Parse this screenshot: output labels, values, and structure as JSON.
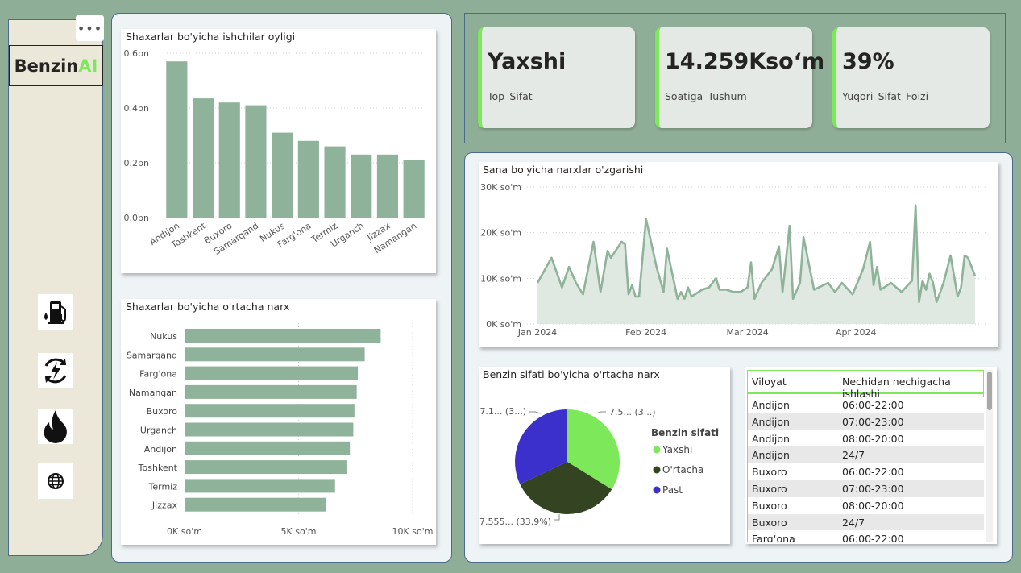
{
  "app": {
    "brand_main": "Benzin",
    "brand_accent": "AI",
    "more_label": "•••"
  },
  "nav": [
    {
      "name": "fuel-station-icon"
    },
    {
      "name": "energy-refresh-icon"
    },
    {
      "name": "flame-icon"
    },
    {
      "name": "globe-icon"
    }
  ],
  "kpis": [
    {
      "value": "Yaxshi",
      "label": "Top_Sifat"
    },
    {
      "value": "14.259Kso‘m",
      "label": "Soatiga_Tushum"
    },
    {
      "value": "39%",
      "label": "Yuqori_Sifat_Foizi"
    }
  ],
  "colors": {
    "bar": "#8fb39a",
    "accent": "#7ee85b",
    "pie_yaxshi": "#7ee85b",
    "pie_ortacha": "#344321",
    "pie_past": "#3b30cc"
  },
  "chart_data": [
    {
      "type": "bar",
      "title": "Shaxarlar bo'yicha ishchilar oyligi",
      "categories": [
        "Andijon",
        "Toshkent",
        "Buxoro",
        "Samarqand",
        "Nukus",
        "Farg'ona",
        "Termiz",
        "Urganch",
        "Jizzax",
        "Namangan"
      ],
      "values": [
        0.57,
        0.435,
        0.42,
        0.41,
        0.31,
        0.28,
        0.26,
        0.23,
        0.23,
        0.21
      ],
      "yticks": [
        "0.0bn",
        "0.2bn",
        "0.4bn",
        "0.6bn"
      ],
      "ylim": [
        0,
        0.6
      ],
      "grid": true
    },
    {
      "type": "bar",
      "orientation": "horizontal",
      "title": "Shaxarlar bo'yicha o'rtacha narx",
      "categories": [
        "Nukus",
        "Samarqand",
        "Farg'ona",
        "Namangan",
        "Buxoro",
        "Urganch",
        "Andijon",
        "Toshkent",
        "Termiz",
        "Jizzax"
      ],
      "values": [
        8600,
        7900,
        7600,
        7550,
        7450,
        7400,
        7250,
        7100,
        6600,
        6200
      ],
      "xticks": [
        "0K so'm",
        "5K so'm",
        "10K so'm"
      ],
      "xlim": [
        0,
        10000
      ],
      "grid": true
    },
    {
      "type": "area",
      "title": "Sana bo'yicha narxlar o'zgarishi",
      "x": [
        "2024-01-01",
        "2024-01-05",
        "2024-01-08",
        "2024-01-10",
        "2024-01-12",
        "2024-01-14",
        "2024-01-17",
        "2024-01-19",
        "2024-01-21",
        "2024-01-22",
        "2024-01-25",
        "2024-01-26",
        "2024-01-27",
        "2024-01-28",
        "2024-01-29",
        "2024-01-30",
        "2024-02-01",
        "2024-02-04",
        "2024-02-06",
        "2024-02-07",
        "2024-02-10",
        "2024-02-11",
        "2024-02-12",
        "2024-02-13",
        "2024-02-14",
        "2024-02-17",
        "2024-02-19",
        "2024-02-21",
        "2024-02-22",
        "2024-02-24",
        "2024-02-26",
        "2024-02-28",
        "2024-03-01",
        "2024-03-02",
        "2024-03-03",
        "2024-03-05",
        "2024-03-08",
        "2024-03-10",
        "2024-03-11",
        "2024-03-13",
        "2024-03-14",
        "2024-03-16",
        "2024-03-17",
        "2024-03-20",
        "2024-03-24",
        "2024-03-26",
        "2024-03-28",
        "2024-03-31",
        "2024-04-03",
        "2024-04-05",
        "2024-04-06",
        "2024-04-07",
        "2024-04-08",
        "2024-04-09",
        "2024-04-11",
        "2024-04-14",
        "2024-04-17",
        "2024-04-18",
        "2024-04-19",
        "2024-04-20",
        "2024-04-21",
        "2024-04-22",
        "2024-04-23",
        "2024-04-24",
        "2024-04-26",
        "2024-04-28",
        "2024-04-30",
        "2024-05-01",
        "2024-05-02",
        "2024-05-03",
        "2024-05-05"
      ],
      "y": [
        9000,
        14500,
        8000,
        12500,
        9000,
        6500,
        18000,
        7000,
        16000,
        14500,
        18000,
        17500,
        6500,
        8500,
        6000,
        6000,
        23000,
        12500,
        7000,
        16500,
        5500,
        7000,
        5500,
        8000,
        6000,
        7500,
        8000,
        10000,
        7500,
        7500,
        7000,
        7000,
        8000,
        13500,
        5500,
        9000,
        12000,
        17000,
        7000,
        21500,
        5500,
        9000,
        19000,
        7500,
        9000,
        7000,
        9000,
        6500,
        12000,
        18000,
        8500,
        12500,
        7500,
        8000,
        9000,
        7000,
        9500,
        26000,
        4800,
        9500,
        7500,
        11000,
        9000,
        4800,
        9000,
        15000,
        6000,
        8000,
        15000,
        14500,
        10500
      ],
      "yticks": [
        "0K so'm",
        "10K so'm",
        "20K so'm",
        "30K so'm"
      ],
      "xticks": [
        "Jan 2024",
        "Feb 2024",
        "Mar 2024",
        "Apr 2024"
      ],
      "ylim": [
        0,
        30000
      ],
      "grid": true
    },
    {
      "type": "pie",
      "title": "Benzin sifati bo'yicha o'rtacha narx",
      "legend_title": "Benzin sifati",
      "labels": [
        "Yaxshi",
        "O'rtacha",
        "Past"
      ],
      "values": [
        7.5,
        7.555,
        7.1
      ],
      "data_labels": [
        "7.5... (3...)",
        "7.555... (33.9%)",
        "7.1... (3...)"
      ]
    }
  ],
  "table": {
    "headers": [
      "Viloyat",
      "Nechidan nechigacha ishlashi"
    ],
    "rows": [
      [
        "Andijon",
        "06:00-22:00"
      ],
      [
        "Andijon",
        "07:00-23:00"
      ],
      [
        "Andijon",
        "08:00-20:00"
      ],
      [
        "Andijon",
        "24/7"
      ],
      [
        "Buxoro",
        "06:00-22:00"
      ],
      [
        "Buxoro",
        "07:00-23:00"
      ],
      [
        "Buxoro",
        "08:00-20:00"
      ],
      [
        "Buxoro",
        "24/7"
      ],
      [
        "Farg‘ona",
        "06:00-22:00"
      ]
    ]
  }
}
